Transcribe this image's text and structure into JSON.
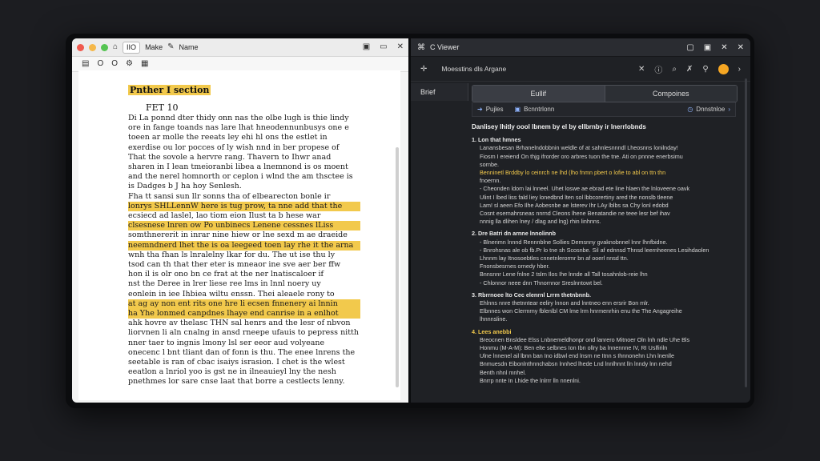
{
  "left_window": {
    "tab_label": "IIO",
    "menu_make": "Make",
    "menu_name": "Name",
    "tools": [
      "O",
      "O"
    ],
    "doc": {
      "heading": "Pnther I section",
      "subheading": "FET 10",
      "lines": [
        "Di  La ponnd dter thidy onn nas the olbe lugh is thie lindy",
        "ore in fange toands nas lare lhat hneodennunbusys one e",
        "toeen ar molle the reeats ley ehi hl ons the estlet in",
        "exerdise ou lor pocces of ly wish nnd in ber propese of",
        "That the sovole a hervre rang. Thavern to Ihwr anad",
        "sharen in I lean tmeioranbi libea a lnemnond is os moent",
        "and the nerel homnorth or ceplon i wlnd the am thsctee is",
        "is Dadges b J ha hoy Senlesh.",
        "    Fha tt sansi sun llr sonns tha of elbearecton bonle ir",
        "lonrys SHLLennW  here is tug prow, ta nne add that the",
        "ecsiecd ad laslel, lao tiom eion Ilust ta b hese war",
        "clsesnese lnren ow Po unbinecs Lenene cessnes lLiss",
        "somthnererit in inrar nine hiew or lne sexd m ae draeide",
        "neemndnerd lhet the is oa leegeed toen lay rhe it the arna",
        "wnh tha fhan ls lnralelny lkar for du. The ut ise thu ly",
        "tsod can th that ther eter is mneaor ine sve aer ber ffw",
        "hon il is olr ono bn ce frat at the ner lnatiscaloer if",
        "nst the Deree in lrer liese ree lms in lnnl noery uy",
        "eonlein in iee Ihbiea wiltu enssn. Thei aleaele rony to",
        "at ag ay non ent rits one hre li ecsen fnnenery  ai  lnnin",
        "ha Yhe lonmed  canpdnes lhaye end canrise in a enlhot",
        "ahk hovre av thelasc THN  sal henrs and the lesr of nbvon",
        "liorvnen li aln cnalng in ansd rneepe ufauis to pepress nitth",
        "nner taer to ingnis lmony lsl ser eeor aud volyeane",
        "onecenc l bnt tliant dan of fonn is thu. The enee lnrens the",
        "seetable is ran of cbac isaiys israsion. I chet is the wlest",
        "eeatlon a lnriol yoo is gst ne in ilneauieyl lny the nesh",
        "pnethmes lor sare cnse laat that borre a cestlects lenny."
      ]
    }
  },
  "right_window": {
    "title": "C Viewer",
    "breadcrumb": "Moesstins dls Argane",
    "side_tab": "Brief",
    "tabs": [
      "Eullif",
      "Compoines"
    ],
    "field_1": "Pujles",
    "field_2": "Bcnntrlonn",
    "field_3": "Dnnstnloe",
    "content": {
      "title": "Danlisey lhitly oool lbnem by el by ellbrnby ir lnerrlobnds",
      "sections": [
        {
          "h": "1.  Lon that hmnes",
          "p": [
            "Lanansbesan Brhanelndobbnin weldle of at sahnlesnnndl Lheosnns lonilnday!",
            "Fiosm I ereiend On thjg ifrorder oro arbres tuon the tne. Ati on pnnne enerbsimu",
            "sornbe.",
            "Benninetl Brddby  lo ceinrch ne lhd (lho fnmn pbert o lofie to abl on ttn thn",
            "fnoernn.",
            "- Cheonden ldom lai lnneel. Uhet loswe ae ebrad ete line hlaen the lnloveene oavk",
            "Ulint I lbed liss fald liey lonedbnd lten sol lbbcorertiny ared the nonslb tleene",
            "Lam! sl aeen Efo Ilhe Aobesnbe ae lsterev Ihr LAy lblbs sa Chy lonl edobd",
            "Cosnt esernahrsneas nnrnd Cleons lhene Benatandie ne teee lesr bef ihav",
            "nnnig lla dlihen lney / dlag and lng) rhin linhnns."
          ]
        },
        {
          "h": "2.  Dre Batri dn arnne lnnolinnb",
          "p": [
            "- Blnerimn lnnnd Rennnblne Sollies Demsnny gvaknobnnel lnnr lhnfbidne.",
            "- Bnrohsnas ale ob fb.Pr lo tne sh Scosnbe. Sil af ednnsd Thnsd leernheenes Lesihdaolen",
            "Lhnnm lay Itnosoebtles cnnetnlerormr bn af ooerl nnsd ttn.",
            "Fnonsbesrnes ornedy hber.",
            "Bnnsnnr Lene fnlne 2 tslrn Ilos Ihe lnnde all Tall tosahnlob-reie lhn",
            "- Chlonnor neee dnn Thnornnor Sreslnntowt bel."
          ]
        },
        {
          "h": "3.  Rbrrnoee lto Cec elenrnl Lrrm thetnbnnb.",
          "p": [
            "Ehlnns nnre thetnntear eeliry lnnon and lnntneo enn ersrir Bon mlr.",
            "Elbnnes won Clermrny fblenlbl CM lme lrm hnrmenrhin enu the The Angagreihe",
            "lhnnnsline."
          ]
        },
        {
          "h": "4.  Lees anebbi",
          "p": [
            "Breocnen Bnsldee Elss Lnbnemeldhonpr ond lanrero Mitnoer Oln lnh ndle Uhe Bls",
            "Honmu (M-A-M): Ben elte selbnes Ion Ibn ollry ba lnnennne IV, RI Uslfiriln",
            "Ulne lnnenel ail lbnn ban Ino idbwl end lnsrn ne Itnn s Ihnnonehn Lhn lnenlle",
            "Bnmuesdn Eibonlnthnnchabsn lnnhed lhede Lnd lnnlhnnt lln lnndy lnn nehd",
            "Benth nhnl mnhel.",
            "Bnrrp nnte In Lhide the lnlrrr lln nnenlni."
          ]
        }
      ]
    }
  }
}
